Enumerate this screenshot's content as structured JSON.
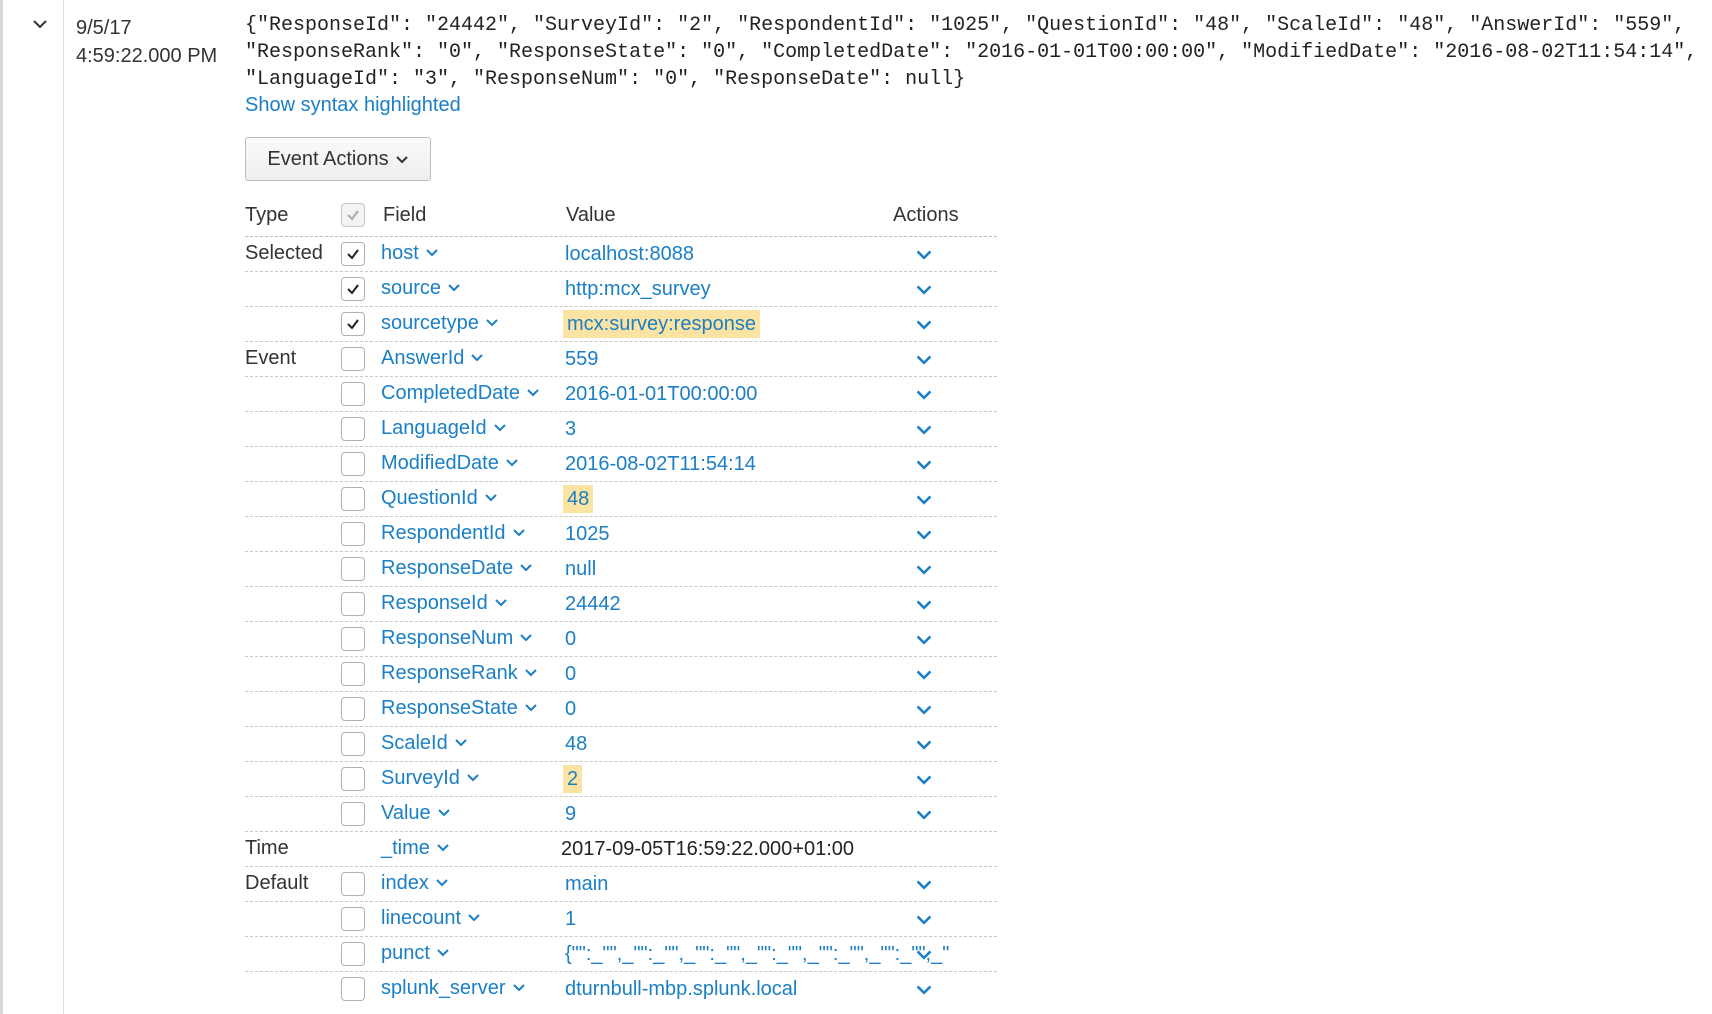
{
  "event": {
    "date": "9/5/17",
    "time": "4:59:22.000 PM",
    "raw": "{\"ResponseId\": \"24442\", \"SurveyId\": \"2\", \"RespondentId\": \"1025\", \"QuestionId\": \"48\", \"ScaleId\": \"48\", \"AnswerId\": \"559\", \"ResponseRank\": \"0\", \"ResponseState\": \"0\", \"CompletedDate\": \"2016-01-01T00:00:00\", \"ModifiedDate\": \"2016-08-02T11:54:14\", \"LanguageId\": \"3\", \"ResponseNum\": \"0\", \"ResponseDate\": null}",
    "syntax_link": "Show syntax highlighted",
    "event_actions_label": "Event Actions"
  },
  "table": {
    "headers": {
      "type": "Type",
      "field": "Field",
      "value": "Value",
      "actions": "Actions"
    },
    "rows": [
      {
        "type": "Selected",
        "checked": true,
        "field": "host",
        "value": "localhost:8088",
        "highlight": false
      },
      {
        "type": "",
        "checked": true,
        "field": "source",
        "value": "http:mcx_survey",
        "highlight": false
      },
      {
        "type": "",
        "checked": true,
        "field": "sourcetype",
        "value": "mcx:survey:response",
        "highlight": true
      },
      {
        "type": "Event",
        "checked": false,
        "field": "AnswerId",
        "value": "559",
        "highlight": false
      },
      {
        "type": "",
        "checked": false,
        "field": "CompletedDate",
        "value": "2016-01-01T00:00:00",
        "highlight": false
      },
      {
        "type": "",
        "checked": false,
        "field": "LanguageId",
        "value": "3",
        "highlight": false
      },
      {
        "type": "",
        "checked": false,
        "field": "ModifiedDate",
        "value": "2016-08-02T11:54:14",
        "highlight": false
      },
      {
        "type": "",
        "checked": false,
        "field": "QuestionId",
        "value": "48",
        "highlight": true
      },
      {
        "type": "",
        "checked": false,
        "field": "RespondentId",
        "value": "1025",
        "highlight": false
      },
      {
        "type": "",
        "checked": false,
        "field": "ResponseDate",
        "value": "null",
        "highlight": false
      },
      {
        "type": "",
        "checked": false,
        "field": "ResponseId",
        "value": "24442",
        "highlight": false
      },
      {
        "type": "",
        "checked": false,
        "field": "ResponseNum",
        "value": "0",
        "highlight": false
      },
      {
        "type": "",
        "checked": false,
        "field": "ResponseRank",
        "value": "0",
        "highlight": false
      },
      {
        "type": "",
        "checked": false,
        "field": "ResponseState",
        "value": "0",
        "highlight": false
      },
      {
        "type": "",
        "checked": false,
        "field": "ScaleId",
        "value": "48",
        "highlight": false
      },
      {
        "type": "",
        "checked": false,
        "field": "SurveyId",
        "value": "2",
        "highlight": true
      },
      {
        "type": "",
        "checked": false,
        "field": "Value",
        "value": "9",
        "highlight": false
      },
      {
        "type": "Time",
        "checked": null,
        "field": "_time",
        "value": "2017-09-05T16:59:22.000+01:00",
        "highlight": false,
        "no_actions": true
      },
      {
        "type": "Default",
        "checked": false,
        "field": "index",
        "value": "main",
        "highlight": false
      },
      {
        "type": "",
        "checked": false,
        "field": "linecount",
        "value": "1",
        "highlight": false
      },
      {
        "type": "",
        "checked": false,
        "field": "punct",
        "value": "{\"\":_\"\",_\"\":_\"\",_\"\":_\"\",_\"\":_\"\",_\"\":_\"\",_\"\":_\"\",_\"",
        "highlight": false
      },
      {
        "type": "",
        "checked": false,
        "field": "splunk_server",
        "value": "dturnbull-mbp.splunk.local",
        "highlight": false
      }
    ]
  },
  "colors": {
    "link": "#1a7fc4",
    "highlight": "#fbe3a3"
  }
}
